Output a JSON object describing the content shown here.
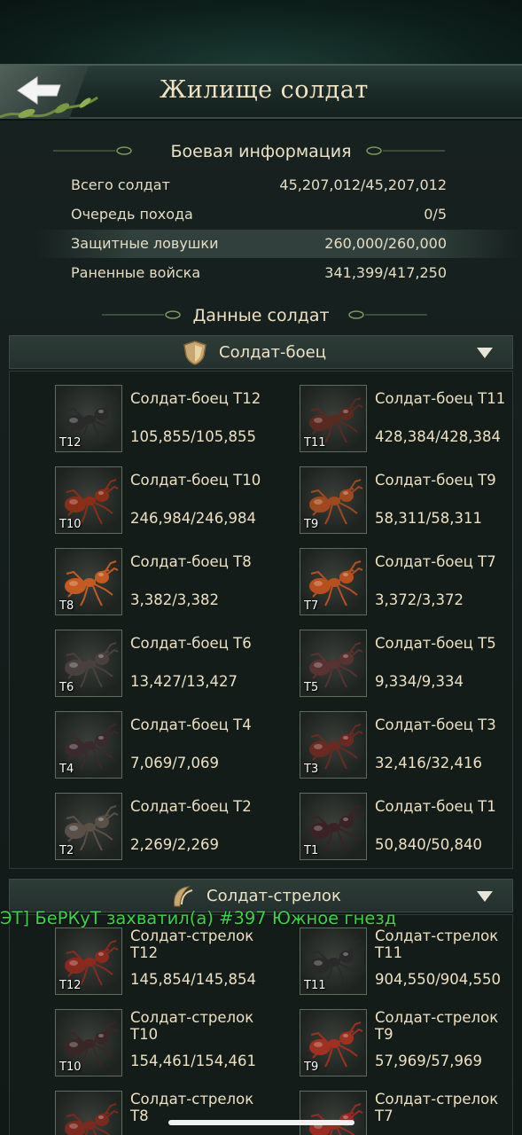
{
  "header": {
    "title": "Жилище солдат"
  },
  "battle_info": {
    "title": "Боевая информация",
    "rows": [
      {
        "label": "Всего солдат",
        "value": "45,207,012/45,207,012"
      },
      {
        "label": "Очередь похода",
        "value": "0/5"
      },
      {
        "label": "Защитные ловушки",
        "value": "260,000/260,000"
      },
      {
        "label": "Раненные войска",
        "value": "341,399/417,250"
      }
    ]
  },
  "soldier_data": {
    "title": "Данные солдат"
  },
  "categories": [
    {
      "label": "Солдат-боец",
      "icon": "shield-icon",
      "units": [
        {
          "name": "Солдат-боец T12",
          "count": "105,855/105,855",
          "tier": "T12",
          "color": "#2a2a2a"
        },
        {
          "name": "Солдат-боец T11",
          "count": "428,384/428,384",
          "tier": "T11",
          "color": "#5a2a20"
        },
        {
          "name": "Солдат-боец T10",
          "count": "246,984/246,984",
          "tier": "T10",
          "color": "#8a2e18"
        },
        {
          "name": "Солдат-боец T9",
          "count": "58,311/58,311",
          "tier": "T9",
          "color": "#a0481e"
        },
        {
          "name": "Солдат-боец T8",
          "count": "3,382/3,382",
          "tier": "T8",
          "color": "#c45a22"
        },
        {
          "name": "Солдат-боец T7",
          "count": "3,372/3,372",
          "tier": "T7",
          "color": "#b8501e"
        },
        {
          "name": "Солдат-боец T6",
          "count": "13,427/13,427",
          "tier": "T6",
          "color": "#4a4040"
        },
        {
          "name": "Солдат-боец T5",
          "count": "9,334/9,334",
          "tier": "T5",
          "color": "#5a3232"
        },
        {
          "name": "Солдат-боец T4",
          "count": "7,069/7,069",
          "tier": "T4",
          "color": "#3a2a30"
        },
        {
          "name": "Солдат-боец T3",
          "count": "32,416/32,416",
          "tier": "T3",
          "color": "#6a2a22"
        },
        {
          "name": "Солдат-боец T2",
          "count": "2,269/2,269",
          "tier": "T2",
          "color": "#5a5048"
        },
        {
          "name": "Солдат-боец T1",
          "count": "50,840/50,840",
          "tier": "T1",
          "color": "#3a2226"
        }
      ]
    },
    {
      "label": "Солдат-стрелок",
      "icon": "bow-icon",
      "units": [
        {
          "name": "Солдат-стрелок T12",
          "count": "145,854/145,854",
          "tier": "T12",
          "color": "#8a2a1e"
        },
        {
          "name": "Солдат-стрелок T11",
          "count": "904,550/904,550",
          "tier": "T11",
          "color": "#2a2a2a"
        },
        {
          "name": "Солдат-стрелок T10",
          "count": "154,461/154,461",
          "tier": "T10",
          "color": "#3a2624"
        },
        {
          "name": "Солдат-стрелок T9",
          "count": "57,969/57,969",
          "tier": "T9",
          "color": "#a03020"
        },
        {
          "name": "Солдат-стрелок T8",
          "count": "",
          "tier": "T8",
          "color": "#7a2a1e"
        },
        {
          "name": "Солдат-стрелок T7",
          "count": "",
          "tier": "T7",
          "color": "#9a2a22"
        }
      ]
    }
  ],
  "ticker": {
    "text": "ЭТ] БеРКуТ захватил(а) #397 Южное гнезд"
  }
}
